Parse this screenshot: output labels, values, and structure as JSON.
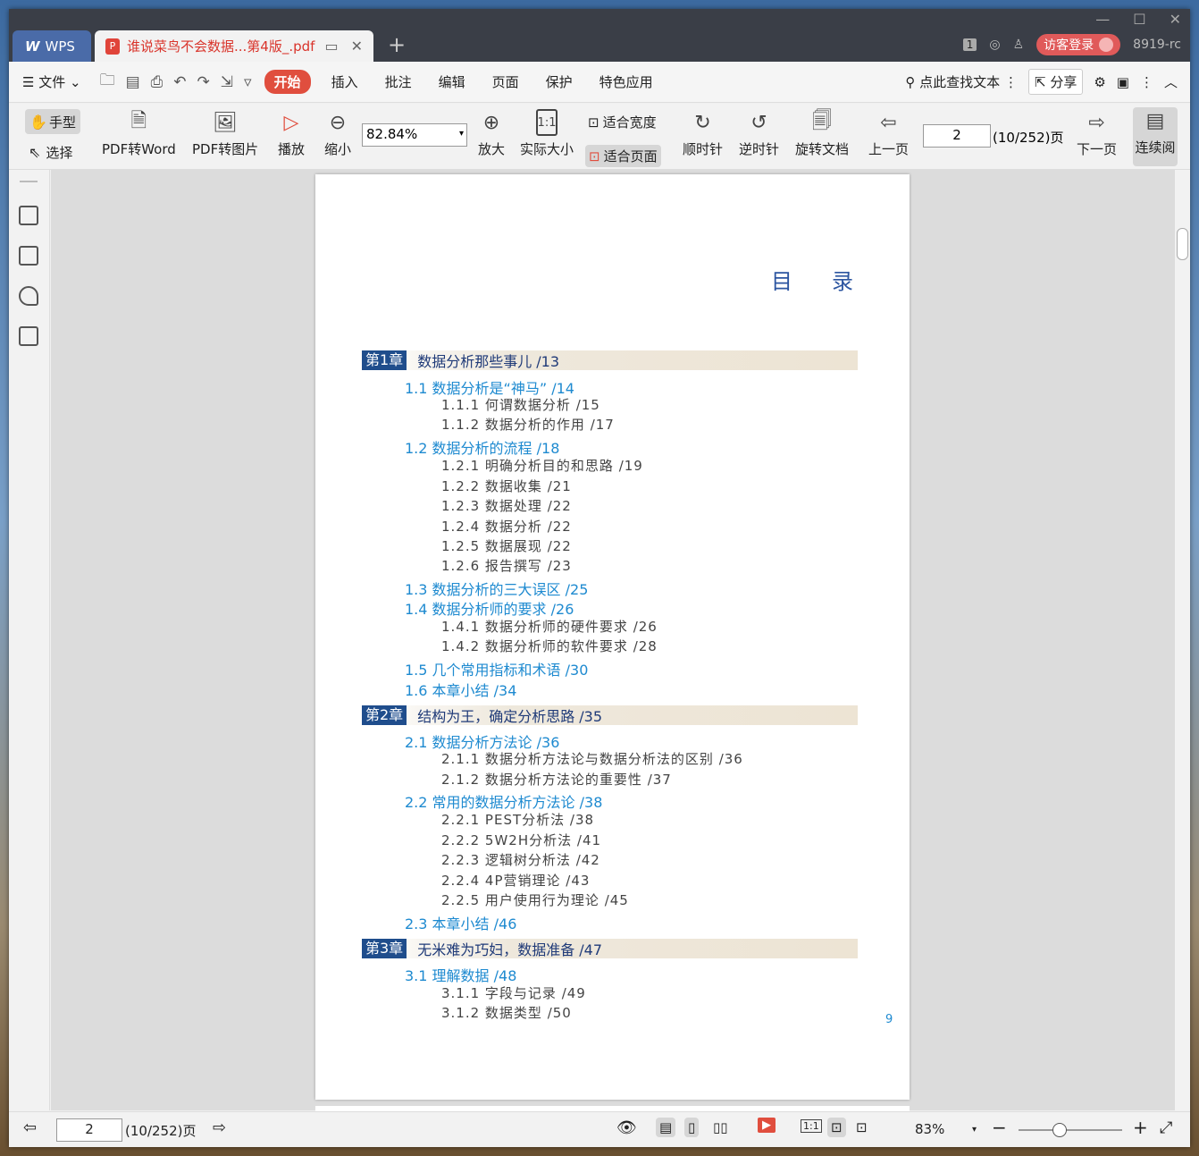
{
  "window": {
    "tabs": [
      {
        "label": "WPS"
      },
      {
        "label": "谁说菜鸟不会数据...第4版_.pdf"
      }
    ],
    "badge": "1",
    "login_label": "访客登录",
    "user_id": "8919-rc"
  },
  "menu": {
    "file": "文件",
    "items": [
      "开始",
      "插入",
      "批注",
      "编辑",
      "页面",
      "保护",
      "特色应用"
    ],
    "search": "点此查找文本",
    "share": "分享"
  },
  "toolbar": {
    "hand": "手型",
    "select": "选择",
    "pdf_to_word": "PDF转Word",
    "pdf_to_image": "PDF转图片",
    "play": "播放",
    "zoom_out": "缩小",
    "zoom_value": "82.84%",
    "zoom_in": "放大",
    "actual_size": "实际大小",
    "fit_width": "适合宽度",
    "fit_page": "适合页面",
    "clockwise": "顺时针",
    "counterclockwise": "逆时针",
    "rotate_doc": "旋转文档",
    "prev_page": "上一页",
    "page_input": "2",
    "page_total": "(10/252)页",
    "next_page": "下一页",
    "continuous": "连续阅"
  },
  "document": {
    "title": "目录",
    "page_number": "9",
    "entries": [
      {
        "type": "chap",
        "label": "第1章",
        "text": "数据分析那些事儿   /13"
      },
      {
        "type": "sec",
        "text": "1.1   数据分析是“神马”    /14"
      },
      {
        "type": "sub",
        "text": "1.1.1   何谓数据分析    /15"
      },
      {
        "type": "sub",
        "text": "1.1.2   数据分析的作用    /17"
      },
      {
        "type": "sec",
        "text": "1.2   数据分析的流程    /18"
      },
      {
        "type": "sub",
        "text": "1.2.1   明确分析目的和思路    /19"
      },
      {
        "type": "sub",
        "text": "1.2.2   数据收集    /21"
      },
      {
        "type": "sub",
        "text": "1.2.3   数据处理    /22"
      },
      {
        "type": "sub",
        "text": "1.2.4   数据分析    /22"
      },
      {
        "type": "sub",
        "text": "1.2.5   数据展现    /22"
      },
      {
        "type": "sub",
        "text": "1.2.6   报告撰写    /23"
      },
      {
        "type": "sec",
        "text": "1.3   数据分析的三大误区    /25"
      },
      {
        "type": "sec",
        "text": "1.4   数据分析师的要求    /26"
      },
      {
        "type": "sub",
        "text": "1.4.1   数据分析师的硬件要求    /26"
      },
      {
        "type": "sub",
        "text": "1.4.2   数据分析师的软件要求    /28"
      },
      {
        "type": "sec",
        "text": "1.5   几个常用指标和术语    /30"
      },
      {
        "type": "sec",
        "text": "1.6   本章小结    /34"
      },
      {
        "type": "chap",
        "label": "第2章",
        "text": "结构为王，确定分析思路    /35"
      },
      {
        "type": "sec",
        "text": "2.1   数据分析方法论    /36"
      },
      {
        "type": "sub",
        "text": "2.1.1   数据分析方法论与数据分析法的区别    /36"
      },
      {
        "type": "sub",
        "text": "2.1.2   数据分析方法论的重要性    /37"
      },
      {
        "type": "sec",
        "text": "2.2   常用的数据分析方法论    /38"
      },
      {
        "type": "sub",
        "text": "2.2.1   PEST分析法    /38"
      },
      {
        "type": "sub",
        "text": "2.2.2   5W2H分析法    /41"
      },
      {
        "type": "sub",
        "text": "2.2.3   逻辑树分析法    /42"
      },
      {
        "type": "sub",
        "text": "2.2.4   4P营销理论    /43"
      },
      {
        "type": "sub",
        "text": "2.2.5   用户使用行为理论    /45"
      },
      {
        "type": "sec",
        "text": "2.3   本章小结    /46"
      },
      {
        "type": "chap",
        "label": "第3章",
        "text": "无米难为巧妇，数据准备    /47"
      },
      {
        "type": "sec",
        "text": "3.1   理解数据    /48"
      },
      {
        "type": "sub",
        "text": "3.1.1   字段与记录    /49"
      },
      {
        "type": "sub",
        "text": "3.1.2   数据类型    /50"
      }
    ]
  },
  "status": {
    "page_input": "2",
    "page_total": "(10/252)页",
    "zoom": "83%"
  },
  "colors": {
    "accent": "#e04e3e",
    "toc_blue": "#1e8ad0",
    "chapter_blue": "#1f4d8c"
  }
}
